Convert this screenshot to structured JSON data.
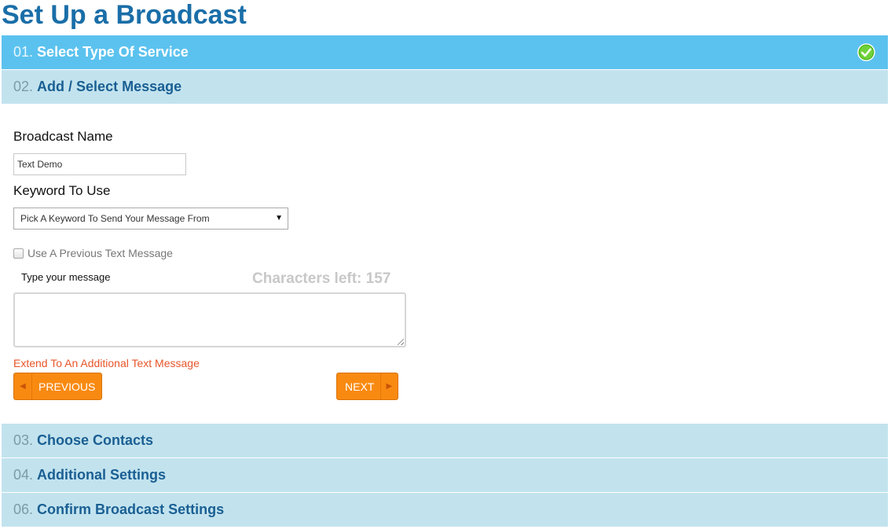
{
  "page": {
    "title": "Set Up a Broadcast"
  },
  "steps": [
    {
      "num": "01.",
      "label": "Select Type Of Service",
      "state": "complete"
    },
    {
      "num": "02.",
      "label": "Add / Select Message",
      "state": "current"
    },
    {
      "num": "03.",
      "label": "Choose Contacts",
      "state": "pending"
    },
    {
      "num": "04.",
      "label": "Additional Settings",
      "state": "pending"
    },
    {
      "num": "06.",
      "label": "Confirm Broadcast Settings",
      "state": "pending"
    }
  ],
  "form": {
    "broadcast_name_label": "Broadcast Name",
    "broadcast_name_value": "Text Demo",
    "keyword_label": "Keyword To Use",
    "keyword_selected": "Pick A Keyword To Send Your Message From",
    "previous_message_label": "Use A Previous Text Message",
    "previous_message_checked": false,
    "message_label": "Type your message",
    "characters_left": "Characters left: 157",
    "message_value": "",
    "extend_link": "Extend To An Additional Text Message",
    "previous_button": "PREVIOUS",
    "next_button": "NEXT"
  },
  "icons": {
    "complete": "check-circle-icon",
    "select_arrow": "triangle-down-icon",
    "previous_arrow": "triangle-left-icon",
    "next_arrow": "triangle-right-icon"
  },
  "colors": {
    "title": "#1a6ea8",
    "step_active_bg": "#5bc2ef",
    "step_bg": "#c2e3ee",
    "step_text": "#1a5f93",
    "button_bg": "#f98a11",
    "link": "#e8552a",
    "check_green": "#4cb517"
  }
}
